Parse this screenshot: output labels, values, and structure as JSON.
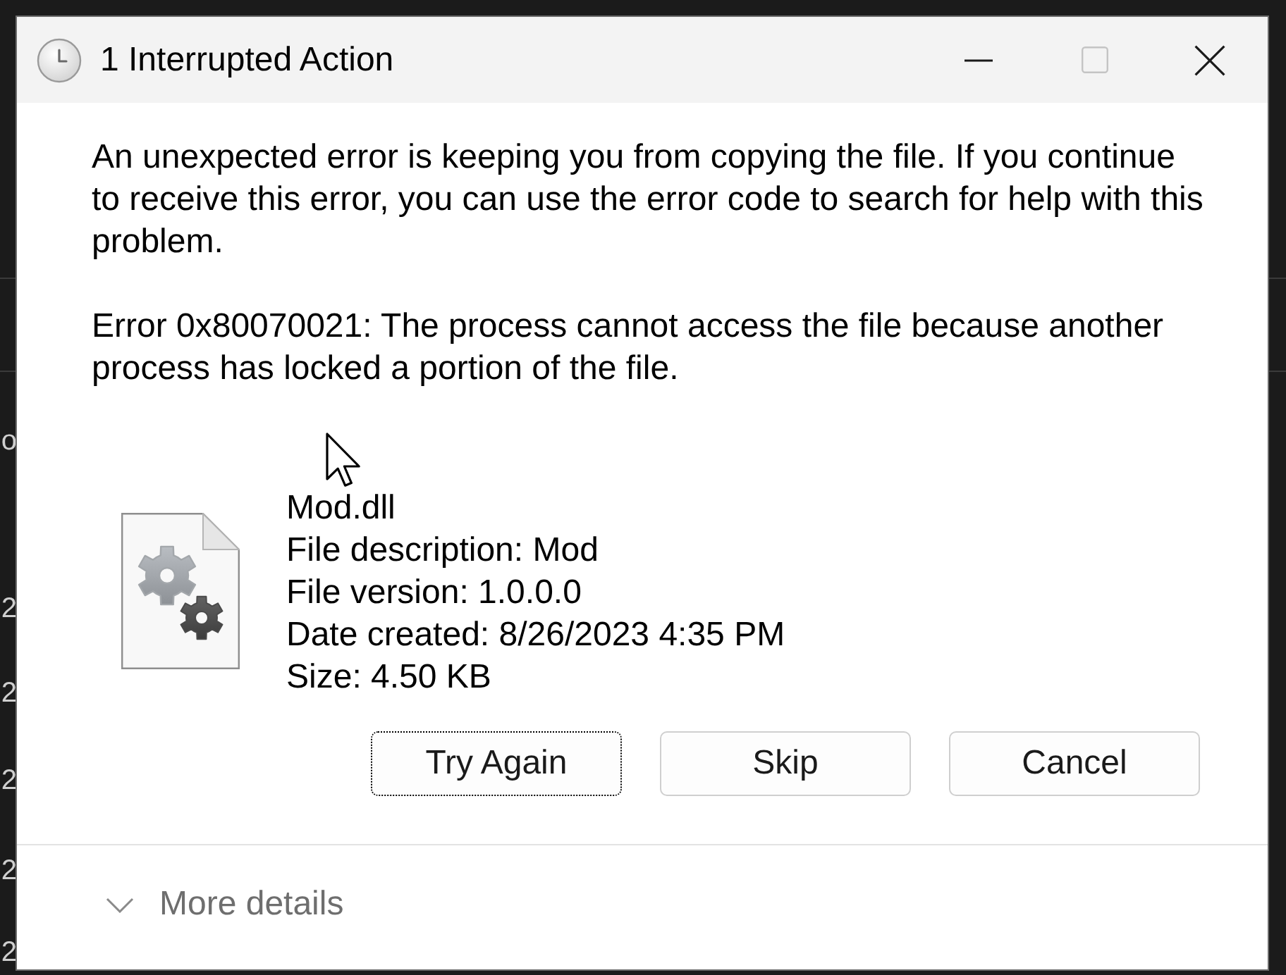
{
  "background_window": {
    "text_fragments": [
      "o",
      "2",
      "2",
      "2",
      "2",
      "2"
    ]
  },
  "window": {
    "title": "1 Interrupted Action",
    "controls": [
      {
        "kind": "minimize",
        "disabled": false
      },
      {
        "kind": "maximize",
        "disabled": true
      },
      {
        "kind": "close",
        "disabled": false
      }
    ]
  },
  "message": "An unexpected error is keeping you from copying the file. If you continue to receive this error, you can use the error code to search for help with this problem.",
  "error": "Error 0x80070021: The process cannot access the file because another process has locked a portion of the file.",
  "file": {
    "name": "Mod.dll",
    "details": [
      "File description: Mod",
      "File version: 1.0.0.0",
      "Date created: 8/26/2023 4:35 PM",
      "Size: 4.50 KB"
    ]
  },
  "buttons": [
    {
      "label": "Try Again",
      "focused": true
    },
    {
      "label": "Skip",
      "focused": false
    },
    {
      "label": "Cancel",
      "focused": false
    }
  ],
  "more_details": {
    "label": "More details",
    "expanded": false
  }
}
